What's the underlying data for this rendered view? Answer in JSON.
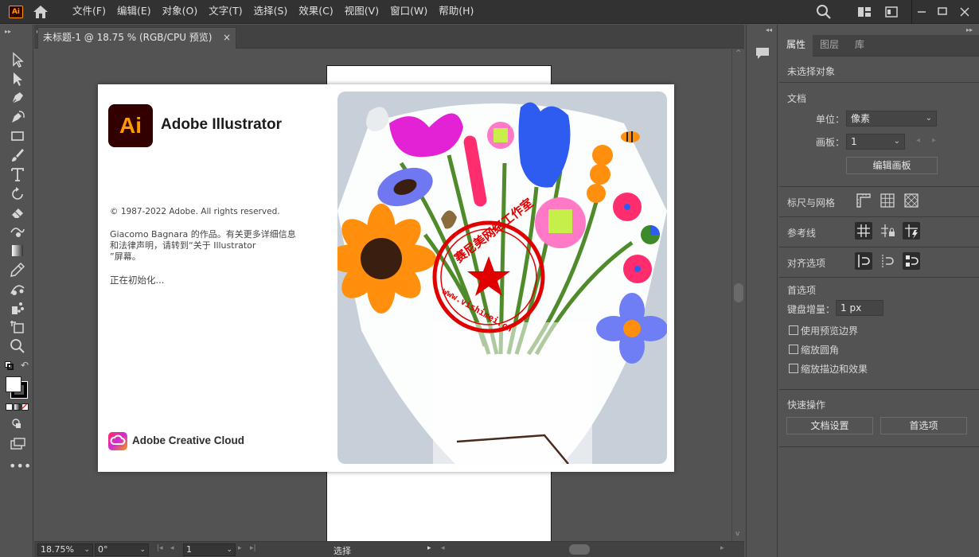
{
  "app": {
    "logo_text": "Ai"
  },
  "menu": [
    "文件(F)",
    "编辑(E)",
    "对象(O)",
    "文字(T)",
    "选择(S)",
    "效果(C)",
    "视图(V)",
    "窗口(W)",
    "帮助(H)"
  ],
  "document_tab": {
    "title": "未标题-1 @ 18.75 % (RGB/CPU 预览)",
    "close": "×"
  },
  "splash": {
    "logo_text": "Ai",
    "product_name": "Adobe Illustrator",
    "copyright": "© 1987-2022 Adobe. All rights reserved.",
    "credits_line1": "Giacomo  Bagnara 的作品。有关更多详细信息",
    "credits_line2": "和法律声明，请转到“关于 Illustrator",
    "credits_line3": "”屏幕。",
    "status": "正在初始化...",
    "cloud_label": "Adobe Creative Cloud",
    "watermark_text": "赛尼美网络工作室",
    "watermark_url": "www.vishimei.cn"
  },
  "panel": {
    "tabs": [
      "属性",
      "图层",
      "库"
    ],
    "no_selection": "未选择对象",
    "document": {
      "heading": "文档",
      "units_label": "单位：",
      "units_value": "像素",
      "artboard_label": "画板：",
      "artboard_value": "1",
      "edit_artboards": "编辑画板"
    },
    "rulers_grids": "标尺与网格",
    "guides": "参考线",
    "align_options": "对齐选项",
    "preferences": {
      "heading": "首选项",
      "keyboard_increment_label": "键盘增量：",
      "keyboard_increment_value": "1 px",
      "use_preview_bounds": "使用预览边界",
      "scale_corners": "缩放圆角",
      "scale_strokes": "缩放描边和效果"
    },
    "quick_actions": {
      "heading": "快速操作",
      "document_setup": "文档设置",
      "preferences": "首选项"
    }
  },
  "status_bar": {
    "zoom": "18.75%",
    "rotation": "0°",
    "artboard": "1",
    "tool": "选择"
  },
  "colors": {
    "ai_bg": "#330000",
    "ai_orange": "#ff9a00",
    "ui_dark": "#323232",
    "ui_mid": "#535353"
  }
}
